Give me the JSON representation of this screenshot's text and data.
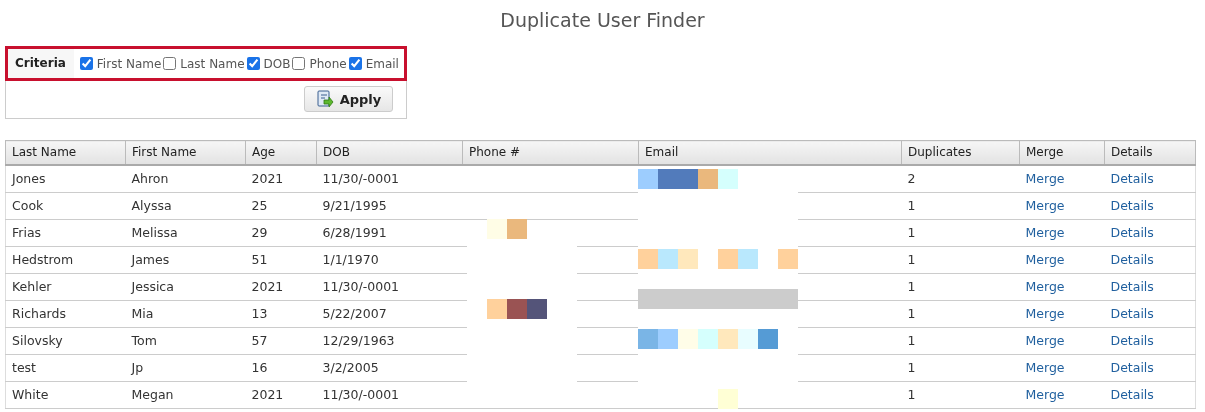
{
  "title": "Duplicate User Finder",
  "criteria": {
    "label": "Criteria",
    "options": [
      {
        "label": "First Name",
        "checked": true
      },
      {
        "label": "Last Name",
        "checked": false
      },
      {
        "label": "DOB",
        "checked": true
      },
      {
        "label": "Phone",
        "checked": false
      },
      {
        "label": "Email",
        "checked": true
      }
    ]
  },
  "apply_button": "Apply",
  "table": {
    "columns": [
      "Last Name",
      "First Name",
      "Age",
      "DOB",
      "Phone #",
      "Email",
      "Duplicates",
      "Merge",
      "Details"
    ],
    "rows": [
      {
        "last_name": "Jones",
        "first_name": "Ahron",
        "age": "2021",
        "dob": "11/30/-0001",
        "duplicates": "2",
        "merge": "Merge",
        "details": "Details"
      },
      {
        "last_name": "Cook",
        "first_name": "Alyssa",
        "age": "25",
        "dob": "9/21/1995",
        "duplicates": "1",
        "merge": "Merge",
        "details": "Details"
      },
      {
        "last_name": "Frias",
        "first_name": "Melissa",
        "age": "29",
        "dob": "6/28/1991",
        "duplicates": "1",
        "merge": "Merge",
        "details": "Details"
      },
      {
        "last_name": "Hedstrom",
        "first_name": "James",
        "age": "51",
        "dob": "1/1/1970",
        "duplicates": "1",
        "merge": "Merge",
        "details": "Details"
      },
      {
        "last_name": "Kehler",
        "first_name": "Jessica",
        "age": "2021",
        "dob": "11/30/-0001",
        "duplicates": "1",
        "merge": "Merge",
        "details": "Details"
      },
      {
        "last_name": "Richards",
        "first_name": "Mia",
        "age": "13",
        "dob": "5/22/2007",
        "duplicates": "1",
        "merge": "Merge",
        "details": "Details"
      },
      {
        "last_name": "Silovsky",
        "first_name": "Tom",
        "age": "57",
        "dob": "12/29/1963",
        "duplicates": "1",
        "merge": "Merge",
        "details": "Details"
      },
      {
        "last_name": "test",
        "first_name": "Jp",
        "age": "16",
        "dob": "3/2/2005",
        "duplicates": "1",
        "merge": "Merge",
        "details": "Details"
      },
      {
        "last_name": "White",
        "first_name": "Megan",
        "age": "2021",
        "dob": "11/30/-0001",
        "duplicates": "1",
        "merge": "Merge",
        "details": "Details"
      }
    ]
  }
}
